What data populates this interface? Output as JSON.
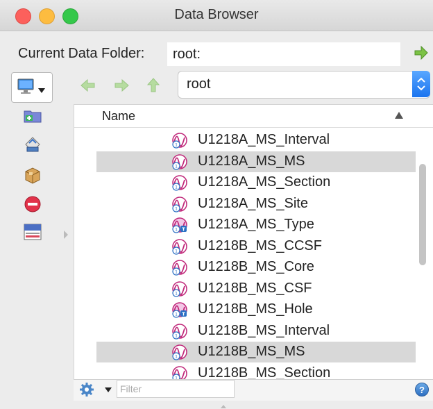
{
  "window": {
    "title": "Data Browser"
  },
  "current_data_folder": {
    "label": "Current Data Folder:",
    "value": "root:"
  },
  "folder_popup": {
    "selected": "root"
  },
  "list": {
    "column_header": "Name",
    "rows": [
      {
        "label": "U1218A_MS_Interval",
        "icon": "wave-icon",
        "selected": false
      },
      {
        "label": "U1218A_MS_MS",
        "icon": "wave-icon",
        "selected": true
      },
      {
        "label": "U1218A_MS_Section",
        "icon": "wave-icon",
        "selected": false
      },
      {
        "label": "U1218A_MS_Site",
        "icon": "wave-icon",
        "selected": false
      },
      {
        "label": "U1218A_MS_Type",
        "icon": "text-wave-icon",
        "selected": false
      },
      {
        "label": "U1218B_MS_CCSF",
        "icon": "wave-icon",
        "selected": false
      },
      {
        "label": "U1218B_MS_Core",
        "icon": "wave-icon",
        "selected": false
      },
      {
        "label": "U1218B_MS_CSF",
        "icon": "wave-icon",
        "selected": false
      },
      {
        "label": "U1218B_MS_Hole",
        "icon": "text-wave-icon",
        "selected": false
      },
      {
        "label": "U1218B_MS_Interval",
        "icon": "wave-icon",
        "selected": false
      },
      {
        "label": "U1218B_MS_MS",
        "icon": "wave-icon",
        "selected": true
      },
      {
        "label": "U1218B_MS_Section",
        "icon": "wave-icon",
        "selected": false
      }
    ]
  },
  "filter": {
    "placeholder": "Filter",
    "value": ""
  },
  "help": {
    "label": "?"
  }
}
